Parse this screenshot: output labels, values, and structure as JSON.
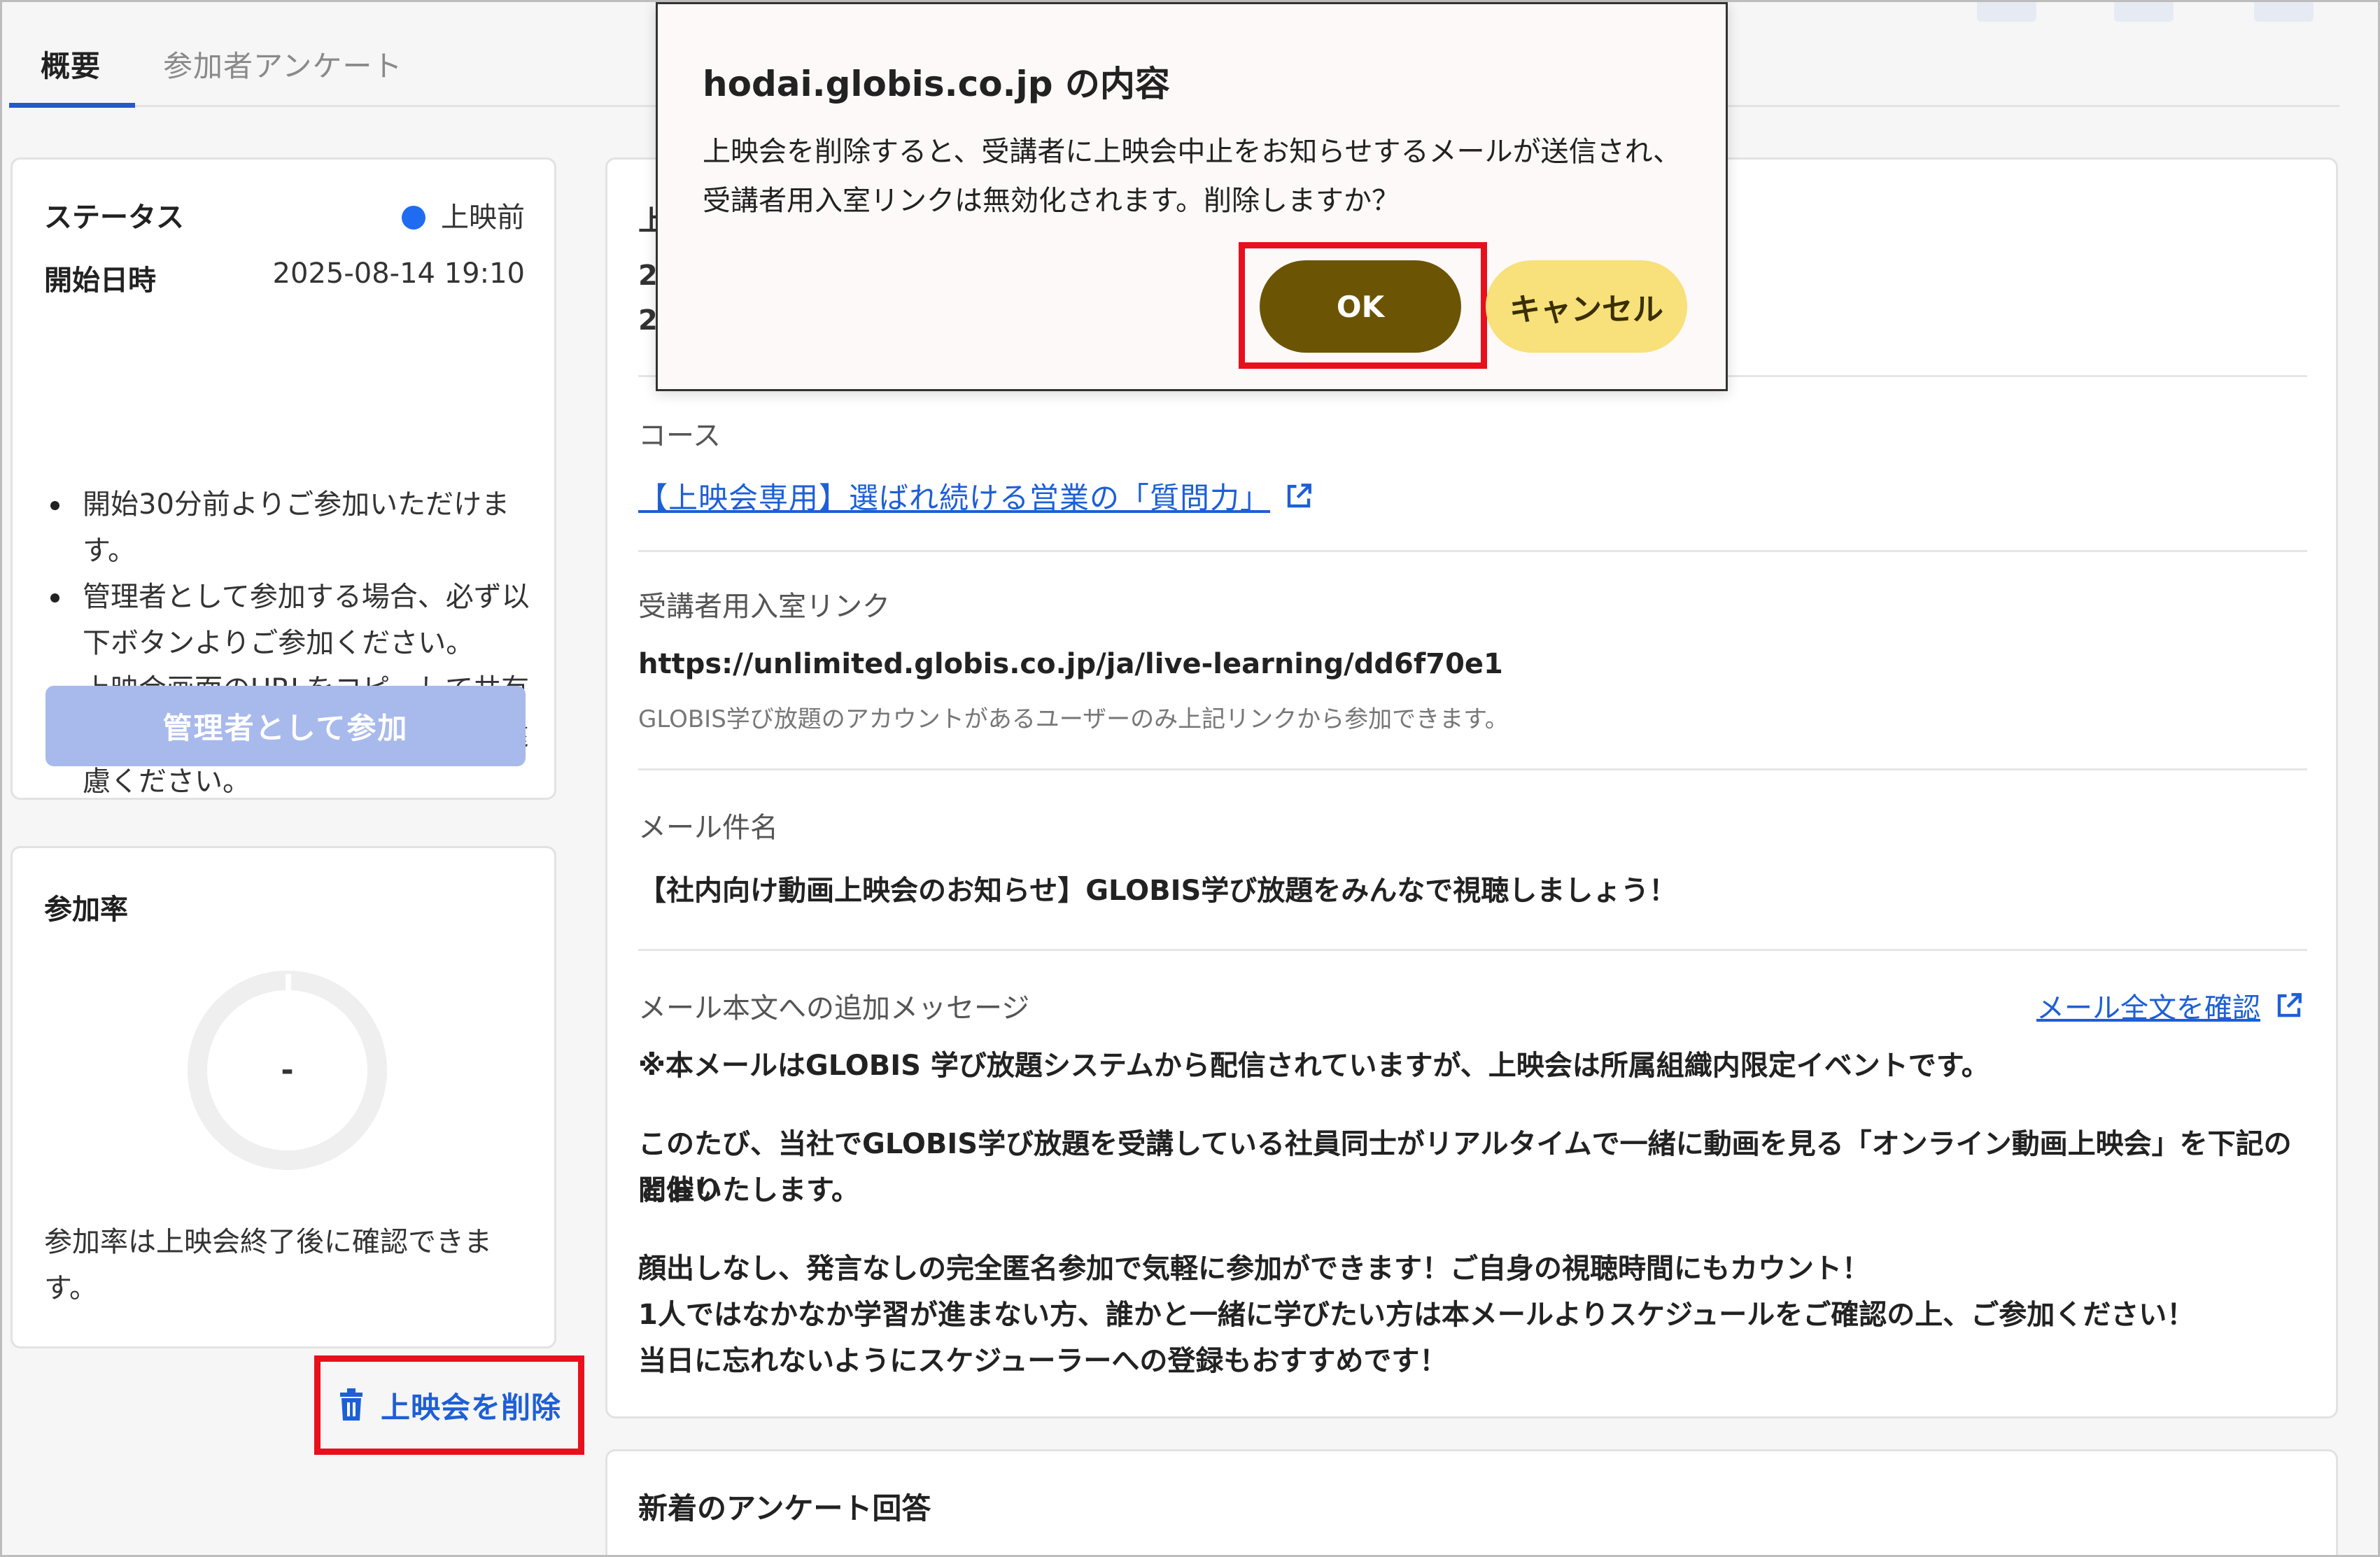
{
  "tabs": [
    {
      "label": "概要"
    },
    {
      "label": "参加者アンケート"
    }
  ],
  "status_card": {
    "status_label": "ステータス",
    "status_value": "上映前",
    "status_color": "#1f6cf0",
    "start_label": "開始日時",
    "start_value": "2025-08-14 19:10",
    "notes": [
      "開始30分前よりご参加いただけます。",
      "管理者として参加する場合、必ず以下ボタンよりご参加ください。",
      "上映会画面のURLをコピーして共有することはセキュリティ観点上ご遠慮ください。"
    ],
    "join_button": "管理者として参加"
  },
  "rate_card": {
    "title": "参加率",
    "value": "-",
    "note": "参加率は上映会終了後に確認できます。"
  },
  "delete_link": {
    "label": "上映会を削除",
    "icon": "trash-icon"
  },
  "main_card": {
    "partial_line_1": "上",
    "partial_line_2": "20",
    "partial_line_3": "20",
    "course_label": "コース",
    "course_link": "【上映会専用】選ばれ続ける営業の「質問力」",
    "room_link_label": "受講者用入室リンク",
    "room_link_url": "https://unlimited.globis.co.jp/ja/live-learning/dd6f70e1",
    "room_link_hint": "GLOBIS学び放題のアカウントがあるユーザーのみ上記リンクから参加できます。",
    "mail_subject_label": "メール件名",
    "mail_subject": "【社内向け動画上映会のお知らせ】GLOBIS学び放題をみんなで視聴しましょう！",
    "mail_message_label": "メール本文への追加メッセージ",
    "mail_fulltext_link": "メール全文を確認",
    "message_p1": "※本メールはGLOBIS 学び放題システムから配信されていますが、上映会は所属組織内限定イベントです。",
    "message_p2a": "このたび、当社でGLOBIS学び放題を受講している社員同士がリアルタイムで一緒に動画を見る「オンライン動画上映会」を下記のとおり",
    "message_p2b": "開催いたします。",
    "message_p3a": "顔出しなし、発言なしの完全匿名参加で気軽に参加ができます！ご自身の視聴時間にもカウント！",
    "message_p3b": "1人ではなかなか学習が進まない方、誰かと一緒に学びたい方は本メールよりスケジュールをご確認の上、ご参加ください！",
    "message_p3c": "当日に忘れないようにスケジューラーへの登録もおすすめです！"
  },
  "survey_card": {
    "title": "新着のアンケート回答"
  },
  "dialog": {
    "title": "hodai.globis.co.jp の内容",
    "message_line1": "上映会を削除すると、受講者に上映会中止をお知らせするメールが送信され、",
    "message_line2": "受講者用入室リンクは無効化されます。削除しますか？",
    "ok": "OK",
    "cancel": "キャンセル"
  },
  "colors": {
    "link": "#1d5fd6",
    "ok_button": "#6b5505",
    "cancel_button": "#f8e07a",
    "highlight": "#e8101c",
    "join_button": "#a8b9ec"
  }
}
